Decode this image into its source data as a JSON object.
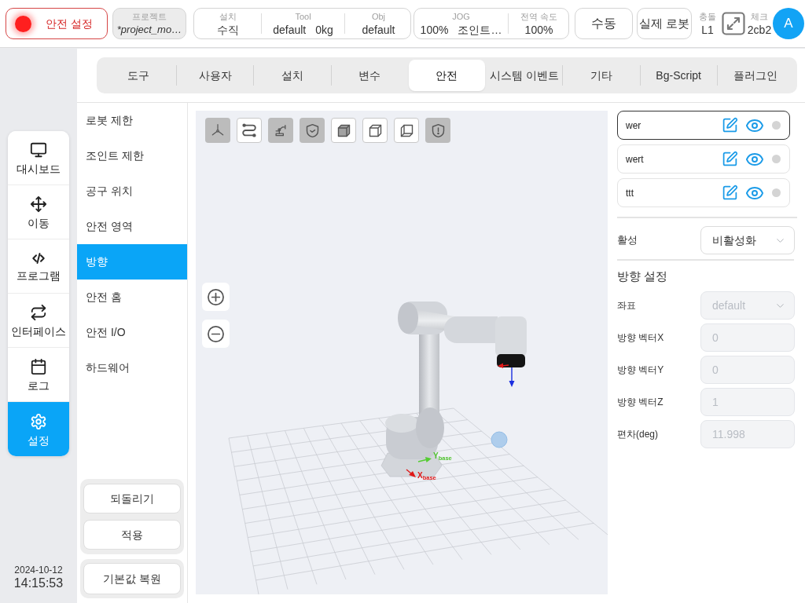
{
  "header": {
    "safety_button": {
      "label": "안전 설정"
    },
    "project": {
      "label": "프로젝트",
      "value": "*project_mo…"
    },
    "info_groups": [
      [
        {
          "label": "설치",
          "values": [
            "수직"
          ]
        },
        {
          "label": "Tool",
          "values": [
            "default",
            "0kg"
          ]
        },
        {
          "label": "Obj",
          "values": [
            "default"
          ]
        }
      ],
      [
        {
          "label": "JOG",
          "values": [
            "100%",
            "조인트…"
          ]
        },
        {
          "label": "전역 속도",
          "values": [
            "100%"
          ]
        }
      ]
    ],
    "mode_button": {
      "label": "수동"
    },
    "robot_button": {
      "label": "실제 로봇"
    },
    "collision": {
      "label": "충돌",
      "value": "L1"
    },
    "check": {
      "label": "체크",
      "value": "2cb2"
    },
    "avatar": {
      "initial": "A"
    }
  },
  "nav": [
    {
      "label": "대시보드",
      "selected": false
    },
    {
      "label": "이동",
      "selected": false
    },
    {
      "label": "프로그램",
      "selected": false
    },
    {
      "label": "인터페이스",
      "selected": false
    },
    {
      "label": "로그",
      "selected": false
    },
    {
      "label": "설정",
      "selected": true
    }
  ],
  "clock": {
    "date": "2024-10-12",
    "time": "14:15:53"
  },
  "tabs": [
    {
      "label": "도구",
      "selected": false
    },
    {
      "label": "사용자",
      "selected": false
    },
    {
      "label": "설치",
      "selected": false
    },
    {
      "label": "변수",
      "selected": false
    },
    {
      "label": "안전",
      "selected": true
    },
    {
      "label": "시스템 이벤트",
      "selected": false
    },
    {
      "label": "기타",
      "selected": false
    },
    {
      "label": "Bg-Script",
      "selected": false
    },
    {
      "label": "플러그인",
      "selected": false
    }
  ],
  "submenu": [
    {
      "label": "로봇 제한",
      "selected": false
    },
    {
      "label": "조인트 제한",
      "selected": false
    },
    {
      "label": "공구 위치",
      "selected": false
    },
    {
      "label": "안전 영역",
      "selected": false
    },
    {
      "label": "방향",
      "selected": true
    },
    {
      "label": "안전 홈",
      "selected": false
    },
    {
      "label": "안전 I/O",
      "selected": false
    },
    {
      "label": "하드웨어",
      "selected": false
    }
  ],
  "side_buttons": [
    {
      "label": "되돌리기"
    },
    {
      "label": "적용"
    }
  ],
  "reset_button": {
    "label": "기본값 복원"
  },
  "viewport": {
    "view_toggles": [
      {
        "active": true
      },
      {
        "active": false
      },
      {
        "active": true
      },
      {
        "active": true
      },
      {
        "active": false
      },
      {
        "active": false
      },
      {
        "active": false
      },
      {
        "active": true
      }
    ],
    "axis_labels": [
      "X$_{base}$",
      "Y$_{base}$"
    ]
  },
  "frames": [
    {
      "name": "wer",
      "selected": true
    },
    {
      "name": "wert",
      "selected": false
    },
    {
      "name": "ttt",
      "selected": false
    }
  ],
  "activation": {
    "label": "활성",
    "value": "비활성화",
    "disabled": false
  },
  "orientation": {
    "title": "방향 설정",
    "fields": [
      {
        "label": "좌표",
        "value": "default",
        "kind": "select",
        "disabled": true
      },
      {
        "label": "방향 벡터X",
        "value": "0",
        "kind": "input",
        "disabled": true
      },
      {
        "label": "방향 벡터Y",
        "value": "0",
        "kind": "input",
        "disabled": true
      },
      {
        "label": "방향 벡터Z",
        "value": "1",
        "kind": "input",
        "disabled": true
      },
      {
        "label": "편차(deg)",
        "value": "11.998",
        "kind": "input",
        "disabled": true
      }
    ]
  }
}
